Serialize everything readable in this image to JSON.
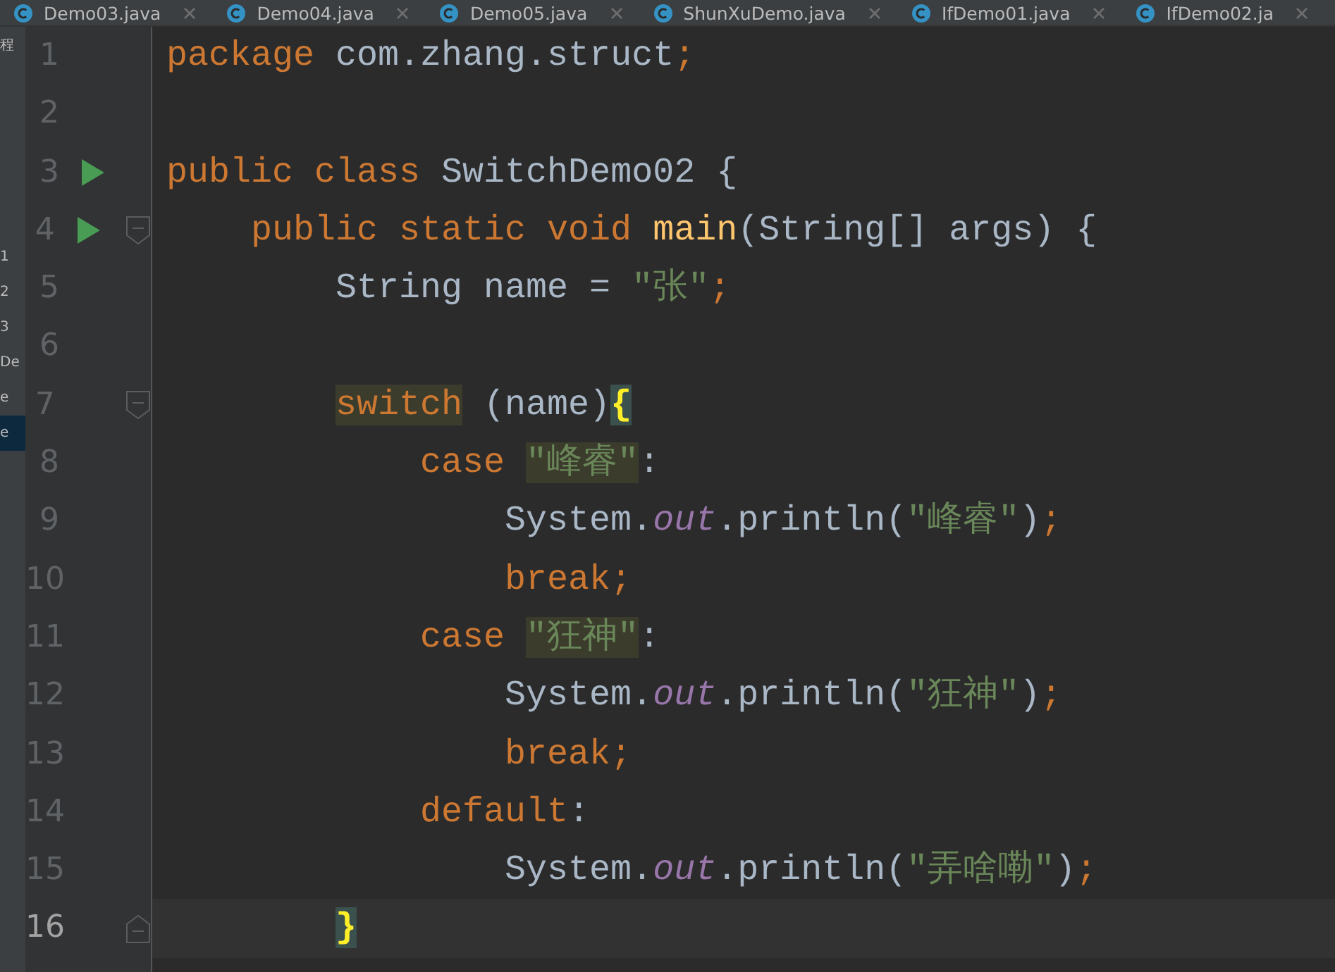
{
  "tabs": [
    {
      "label": "Demo03.java"
    },
    {
      "label": "Demo04.java"
    },
    {
      "label": "Demo05.java"
    },
    {
      "label": "ShunXuDemo.java"
    },
    {
      "label": "IfDemo01.java"
    },
    {
      "label": "IfDemo02.ja"
    }
  ],
  "sidebar_fragments": [
    {
      "text": "程",
      "selected": false
    },
    {
      "text": "1",
      "selected": false
    },
    {
      "text": "2",
      "selected": false
    },
    {
      "text": "3",
      "selected": false
    },
    {
      "text": "De",
      "selected": false
    },
    {
      "text": "e",
      "selected": false
    },
    {
      "text": "e",
      "selected": true
    }
  ],
  "lines": [
    {
      "number": "1",
      "run": false,
      "fold_start": false,
      "fold_end": false,
      "current": false,
      "tokens": [
        {
          "text": "package ",
          "kind": "keyword"
        },
        {
          "text": "com.zhang.struct",
          "kind": "plain"
        },
        {
          "text": ";",
          "kind": "keyword"
        }
      ]
    },
    {
      "number": "2",
      "run": false,
      "fold_start": false,
      "fold_end": false,
      "current": false
    },
    {
      "number": "3",
      "run": true,
      "fold_start": false,
      "fold_end": false,
      "current": false,
      "tokens": [
        {
          "text": "public class ",
          "kind": "keyword"
        },
        {
          "text": "SwitchDemo02 {",
          "kind": "plain"
        }
      ]
    },
    {
      "number": "4",
      "run": true,
      "fold_start": true,
      "fold_end": false,
      "current": false,
      "tokens": [
        {
          "text": "    public static void ",
          "kind": "keyword"
        },
        {
          "text": "main",
          "kind": "method"
        },
        {
          "text": "(String[] args) {",
          "kind": "plain"
        }
      ]
    },
    {
      "number": "5",
      "run": false,
      "fold_start": false,
      "fold_end": false,
      "current": false,
      "tokens": [
        {
          "text": "        String name = ",
          "kind": "plain"
        },
        {
          "text": "\"张\"",
          "kind": "string"
        },
        {
          "text": ";",
          "kind": "keyword"
        }
      ]
    },
    {
      "number": "6",
      "run": false,
      "fold_start": false,
      "fold_end": false,
      "current": false
    },
    {
      "number": "7",
      "run": false,
      "fold_start": true,
      "fold_end": false,
      "current": false,
      "tokens": [
        {
          "text": "        switch",
          "kind": "keyhit"
        },
        {
          "text": " (name)",
          "kind": "plain"
        },
        {
          "text": "{",
          "kind": "bracehit"
        }
      ]
    },
    {
      "number": "8",
      "run": false,
      "fold_start": false,
      "fold_end": false,
      "current": false,
      "tokens": [
        {
          "text": "            case ",
          "kind": "keyword"
        },
        {
          "text": "\"峰睿\"",
          "kind": "stringhit"
        },
        {
          "text": ":",
          "kind": "plain"
        }
      ]
    },
    {
      "number": "9",
      "run": false,
      "fold_start": false,
      "fold_end": false,
      "current": false,
      "tokens": [
        {
          "text": "                System.",
          "kind": "plain"
        },
        {
          "text": "out",
          "kind": "field"
        },
        {
          "text": ".println(",
          "kind": "plain"
        },
        {
          "text": "\"峰睿\"",
          "kind": "string"
        },
        {
          "text": ")",
          "kind": "plain"
        },
        {
          "text": ";",
          "kind": "keyword"
        }
      ]
    },
    {
      "number": "10",
      "run": false,
      "fold_start": false,
      "fold_end": false,
      "current": false,
      "tokens": [
        {
          "text": "                break;",
          "kind": "keyword"
        }
      ]
    },
    {
      "number": "11",
      "run": false,
      "fold_start": false,
      "fold_end": false,
      "current": false,
      "tokens": [
        {
          "text": "            case ",
          "kind": "keyword"
        },
        {
          "text": "\"狂神\"",
          "kind": "stringhit"
        },
        {
          "text": ":",
          "kind": "plain"
        }
      ]
    },
    {
      "number": "12",
      "run": false,
      "fold_start": false,
      "fold_end": false,
      "current": false,
      "tokens": [
        {
          "text": "                System.",
          "kind": "plain"
        },
        {
          "text": "out",
          "kind": "field"
        },
        {
          "text": ".println(",
          "kind": "plain"
        },
        {
          "text": "\"狂神\"",
          "kind": "string"
        },
        {
          "text": ")",
          "kind": "plain"
        },
        {
          "text": ";",
          "kind": "keyword"
        }
      ]
    },
    {
      "number": "13",
      "run": false,
      "fold_start": false,
      "fold_end": false,
      "current": false,
      "tokens": [
        {
          "text": "                break;",
          "kind": "keyword"
        }
      ]
    },
    {
      "number": "14",
      "run": false,
      "fold_start": false,
      "fold_end": false,
      "current": false,
      "tokens": [
        {
          "text": "            default",
          "kind": "keyword"
        },
        {
          "text": ":",
          "kind": "plain"
        }
      ]
    },
    {
      "number": "15",
      "run": false,
      "fold_start": false,
      "fold_end": false,
      "current": false,
      "tokens": [
        {
          "text": "                System.",
          "kind": "plain"
        },
        {
          "text": "out",
          "kind": "field"
        },
        {
          "text": ".println(",
          "kind": "plain"
        },
        {
          "text": "\"弄啥嘞\"",
          "kind": "string"
        },
        {
          "text": ")",
          "kind": "plain"
        },
        {
          "text": ";",
          "kind": "keyword"
        }
      ]
    },
    {
      "number": "16",
      "run": false,
      "fold_start": false,
      "fold_end": true,
      "current": true,
      "tokens": [
        {
          "text": "        }",
          "kind": "bracehit"
        }
      ]
    }
  ]
}
